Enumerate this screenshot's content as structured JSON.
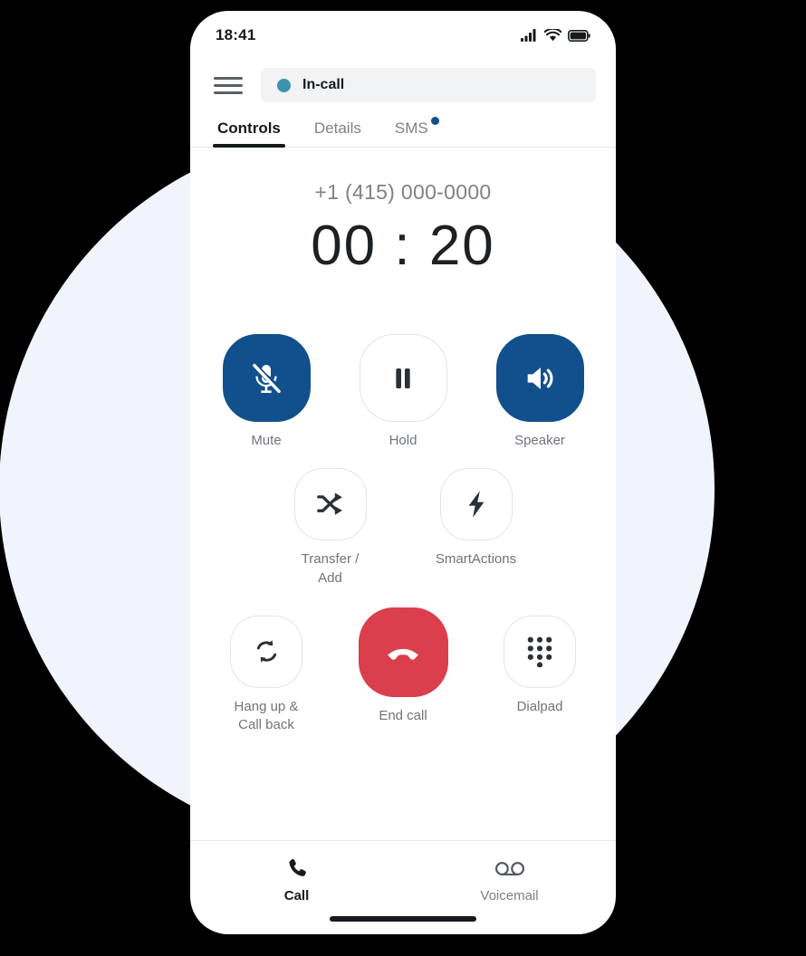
{
  "colors": {
    "accent_blue": "#11508C",
    "danger_red": "#DB3E4C",
    "status_teal": "#3B93B0",
    "backdrop": "#F1F4FD",
    "text_primary": "#16191D",
    "text_muted": "#7C8289"
  },
  "status_bar": {
    "time": "18:41",
    "signal_icon": "cellular-signal-icon",
    "wifi_icon": "wifi-icon",
    "battery_icon": "battery-full-icon"
  },
  "header": {
    "menu_icon": "hamburger-menu-icon",
    "status": {
      "dot_icon": "status-dot-icon",
      "label": "In-call"
    }
  },
  "tabs": [
    {
      "label": "Controls",
      "active": true,
      "badge": false
    },
    {
      "label": "Details",
      "active": false,
      "badge": false
    },
    {
      "label": "SMS",
      "active": false,
      "badge": true
    }
  ],
  "call": {
    "number": "+1 (415) 000-0000",
    "timer": "00 : 20"
  },
  "controls": [
    {
      "label": "Mute",
      "icon": "microphone-muted-icon",
      "style": "filled-blue",
      "size": "large"
    },
    {
      "label": "Hold",
      "icon": "pause-icon",
      "style": "outline",
      "size": "large"
    },
    {
      "label": "Speaker",
      "icon": "speaker-icon",
      "style": "filled-blue",
      "size": "large"
    },
    {
      "label": "Transfer /\nAdd",
      "icon": "shuffle-transfer-icon",
      "style": "outline",
      "size": "large"
    },
    {
      "label": "SmartActions",
      "icon": "lightning-bolt-icon",
      "style": "outline",
      "size": "large"
    },
    {
      "label": "Hang up &\nCall back",
      "icon": "refresh-callback-icon",
      "style": "outline",
      "size": "small"
    },
    {
      "label": "End call",
      "icon": "end-call-icon",
      "style": "filled-red",
      "size": "large"
    },
    {
      "label": "Dialpad",
      "icon": "dialpad-icon",
      "style": "outline",
      "size": "small"
    }
  ],
  "control_labels": {
    "mute": "Mute",
    "hold": "Hold",
    "speaker": "Speaker",
    "transfer_line1": "Transfer /",
    "transfer_line2": "Add",
    "smartactions": "SmartActions",
    "hangup_line1": "Hang up &",
    "hangup_line2": "Call back",
    "end_call": "End call",
    "dialpad": "Dialpad"
  },
  "bottom_nav": [
    {
      "label": "Call",
      "icon": "phone-icon",
      "active": true
    },
    {
      "label": "Voicemail",
      "icon": "voicemail-icon",
      "active": false
    }
  ]
}
